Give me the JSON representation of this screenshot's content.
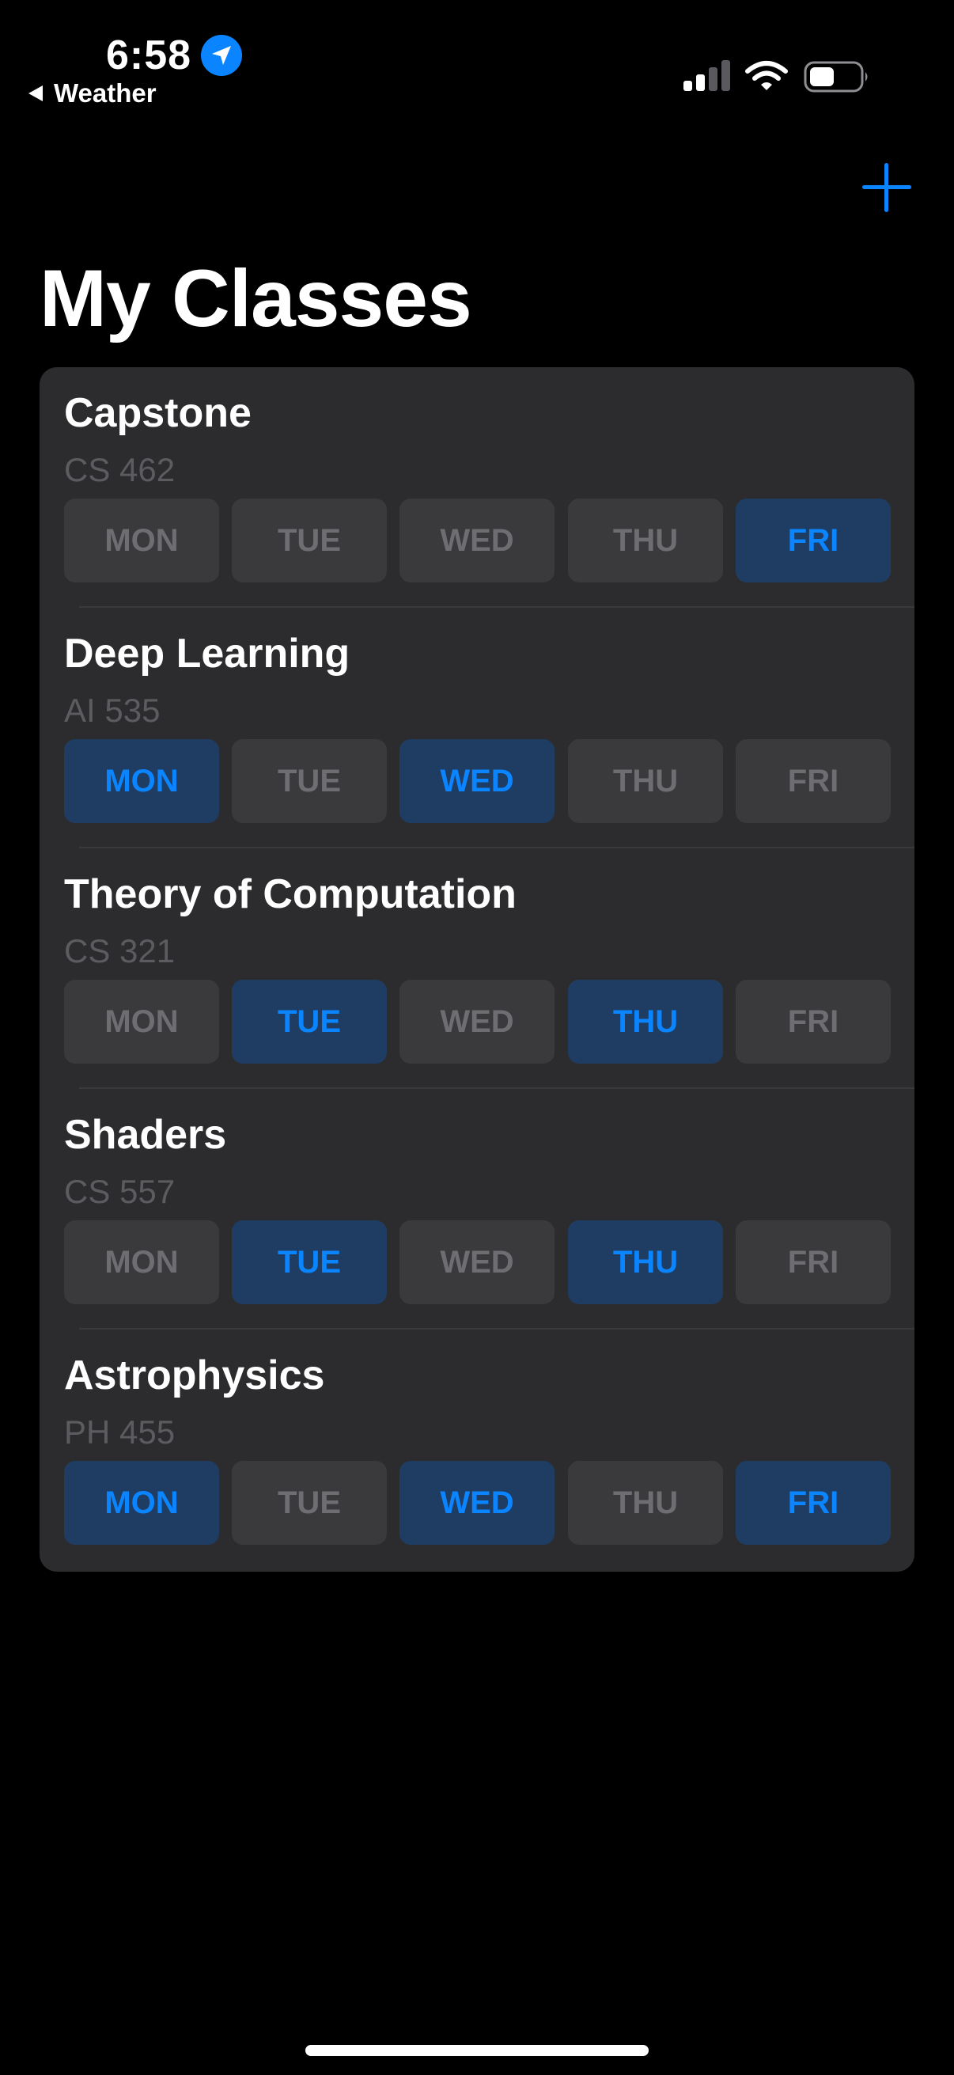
{
  "status_bar": {
    "time": "6:58",
    "back_app": "Weather"
  },
  "header": {
    "title": "My Classes",
    "add_icon": "plus-icon"
  },
  "colors": {
    "background": "#000000",
    "card": "#2c2c2e",
    "chip_inactive_bg": "#3a3a3c",
    "chip_inactive_text": "#6d6d72",
    "chip_active_bg": "#1f3d63",
    "accent": "#0a84ff"
  },
  "classes": [
    {
      "name": "Capstone",
      "code": "CS 462",
      "days": [
        {
          "label": "MON",
          "active": false
        },
        {
          "label": "TUE",
          "active": false
        },
        {
          "label": "WED",
          "active": false
        },
        {
          "label": "THU",
          "active": false
        },
        {
          "label": "FRI",
          "active": true
        }
      ]
    },
    {
      "name": "Deep Learning",
      "code": "AI 535",
      "days": [
        {
          "label": "MON",
          "active": true
        },
        {
          "label": "TUE",
          "active": false
        },
        {
          "label": "WED",
          "active": true
        },
        {
          "label": "THU",
          "active": false
        },
        {
          "label": "FRI",
          "active": false
        }
      ]
    },
    {
      "name": "Theory of Computation",
      "code": "CS 321",
      "days": [
        {
          "label": "MON",
          "active": false
        },
        {
          "label": "TUE",
          "active": true
        },
        {
          "label": "WED",
          "active": false
        },
        {
          "label": "THU",
          "active": true
        },
        {
          "label": "FRI",
          "active": false
        }
      ]
    },
    {
      "name": "Shaders",
      "code": "CS 557",
      "days": [
        {
          "label": "MON",
          "active": false
        },
        {
          "label": "TUE",
          "active": true
        },
        {
          "label": "WED",
          "active": false
        },
        {
          "label": "THU",
          "active": true
        },
        {
          "label": "FRI",
          "active": false
        }
      ]
    },
    {
      "name": "Astrophysics",
      "code": "PH 455",
      "days": [
        {
          "label": "MON",
          "active": true
        },
        {
          "label": "TUE",
          "active": false
        },
        {
          "label": "WED",
          "active": true
        },
        {
          "label": "THU",
          "active": false
        },
        {
          "label": "FRI",
          "active": true
        }
      ]
    }
  ]
}
